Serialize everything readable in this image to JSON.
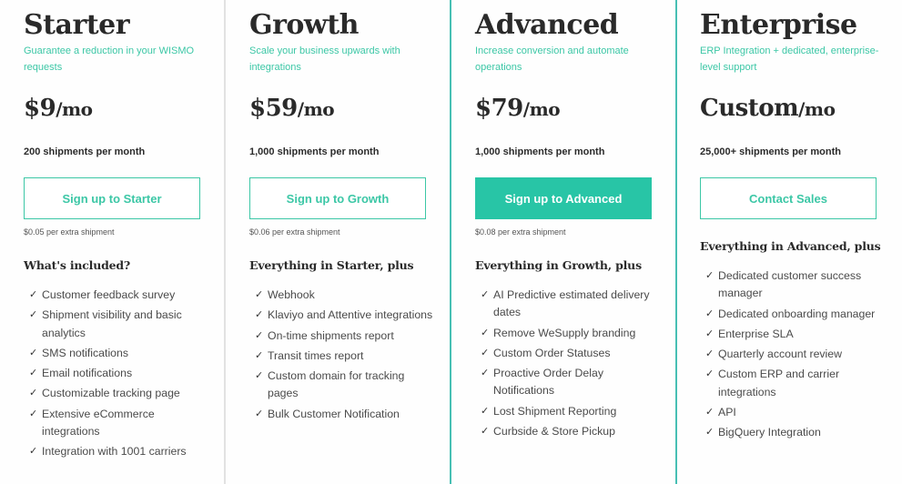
{
  "colors": {
    "accent": "#3cc7a6",
    "accent_filled": "#28c5a6",
    "highlight_border": "#47bfb4",
    "divider": "#e2e2e2",
    "text_dark": "#2a2a2a"
  },
  "icons": {
    "check": "✓"
  },
  "plans": [
    {
      "title": "Starter",
      "tagline": "Guarantee a reduction in your WISMO requests",
      "price": "$9",
      "period": "/mo",
      "shipments": "200 shipments per month",
      "cta": "Sign up to Starter",
      "cta_style": "outline",
      "extra": "$0.05 per extra shipment",
      "features_heading": "What's included?",
      "features": [
        "Customer feedback survey",
        "Shipment visibility and basic analytics",
        "SMS notifications",
        "Email notifications",
        "Customizable tracking page",
        "Extensive eCommerce integrations",
        "Integration with 1001 carriers"
      ]
    },
    {
      "title": "Growth",
      "tagline": "Scale your business upwards with integrations",
      "price": "$59",
      "period": "/mo",
      "shipments": "1,000 shipments per month",
      "cta": "Sign up to Growth",
      "cta_style": "outline",
      "extra": "$0.06 per extra shipment",
      "features_heading": "Everything in Starter, plus",
      "features": [
        "Webhook",
        "Klaviyo and Attentive integrations",
        "On-time shipments report",
        "Transit times report",
        "Custom domain for tracking pages",
        "Bulk Customer Notification"
      ]
    },
    {
      "title": "Advanced",
      "tagline": "Increase conversion and automate operations",
      "price": "$79",
      "period": "/mo",
      "shipments": "1,000 shipments per month",
      "cta": "Sign up to Advanced",
      "cta_style": "filled",
      "extra": "$0.08 per extra shipment",
      "features_heading": "Everything in Growth, plus",
      "features": [
        "AI Predictive estimated delivery dates",
        "Remove WeSupply branding",
        "Custom Order Statuses",
        "Proactive Order Delay Notifications",
        "Lost Shipment Reporting",
        "Curbside & Store Pickup"
      ]
    },
    {
      "title": "Enterprise",
      "tagline": "ERP Integration + dedicated, enterprise-level support",
      "price": "Custom",
      "period": "/mo",
      "shipments": "25,000+ shipments per month",
      "cta": "Contact Sales",
      "cta_style": "outline",
      "features_heading": "Everything in Advanced, plus",
      "features": [
        "Dedicated customer success manager",
        "Dedicated onboarding manager",
        "Enterprise SLA",
        "Quarterly account review",
        "Custom ERP and carrier integrations",
        "API",
        "BigQuery Integration"
      ]
    }
  ]
}
